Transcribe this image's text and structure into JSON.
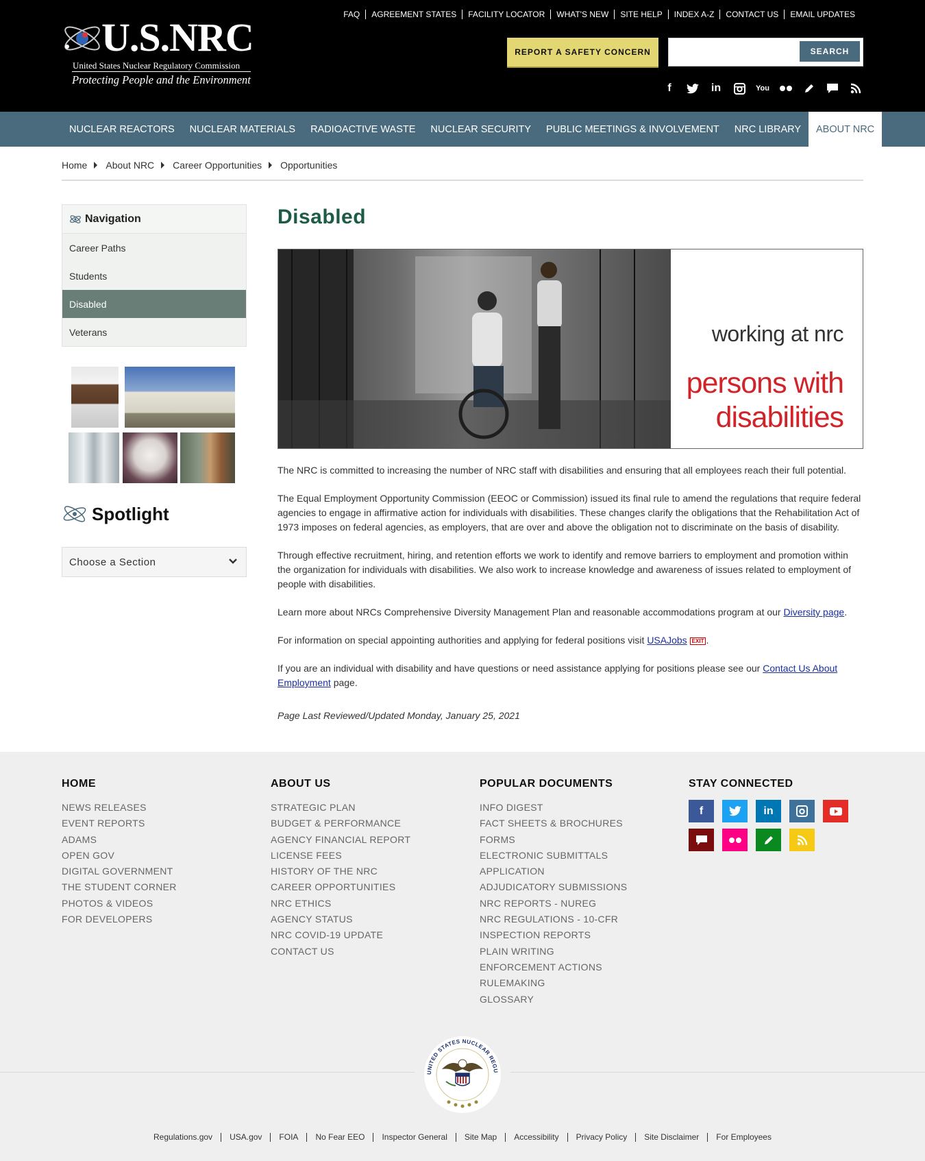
{
  "header": {
    "brand": "U.S.NRC",
    "agency_name": "United States Nuclear Regulatory Commission",
    "tagline": "Protecting People and the Environment",
    "util_links": [
      "FAQ",
      "AGREEMENT STATES",
      "FACILITY LOCATOR",
      "WHAT'S NEW",
      "SITE HELP",
      "INDEX A-Z",
      "CONTACT US",
      "EMAIL UPDATES"
    ],
    "report_button": "REPORT A SAFETY CONCERN",
    "search": {
      "placeholder": "",
      "button": "SEARCH"
    },
    "social_icons": [
      "facebook-icon",
      "twitter-icon",
      "linkedin-icon",
      "instagram-icon",
      "youtube-icon",
      "flickr-icon",
      "blog-icon",
      "comment-icon",
      "rss-icon"
    ]
  },
  "main_nav": {
    "items": [
      "NUCLEAR REACTORS",
      "NUCLEAR MATERIALS",
      "RADIOACTIVE WASTE",
      "NUCLEAR SECURITY",
      "PUBLIC MEETINGS & INVOLVEMENT",
      "NRC LIBRARY",
      "ABOUT NRC"
    ],
    "active": "ABOUT NRC"
  },
  "breadcrumb": [
    "Home",
    "About NRC",
    "Career Opportunities",
    "Opportunities"
  ],
  "sidebar": {
    "nav_title": "Navigation",
    "items": [
      "Career Paths",
      "Students",
      "Disabled",
      "Veterans"
    ],
    "active": "Disabled",
    "spotlight_title": "Spotlight",
    "choose_section": "Choose a Section"
  },
  "content": {
    "title": "Disabled",
    "hero": {
      "line1": "working at nrc",
      "line2a": "persons with",
      "line2b": "disabilities"
    },
    "p1": "The NRC is committed to increasing the number of NRC staff with disabilities and ensuring that all employees reach their full potential.",
    "p2": "The Equal Employment Opportunity Commission (EEOC or Commission) issued its final rule to amend the regulations that require federal agencies to engage in affirmative action for individuals with disabilities. These changes clarify the obligations that the Rehabilitation Act of 1973 imposes on federal agencies, as employers, that are over and above the obligation not to discriminate on the basis of disability.",
    "p3": "Through effective recruitment, hiring, and retention efforts we work to identify and remove barriers to employment and promotion within the organization for individuals with disabilities. We also work to increase knowledge and awareness of issues related to employment of people with disabilities.",
    "p4_pre": "Learn more about NRCs Comprehensive Diversity Management Plan and reasonable accommodations program at our ",
    "p4_link": "Diversity page",
    "p4_post": ".",
    "p5_pre": "For information on special appointing authorities and applying for federal positions visit ",
    "p5_link": "USAJobs",
    "p5_exit": "EXIT",
    "p5_post": ".",
    "p6_pre": "If you are an individual with disability and have questions or need assistance applying for positions please see our ",
    "p6_link": "Contact Us About Employment",
    "p6_post": " page.",
    "reviewed": "Page Last Reviewed/Updated Monday, January 25, 2021"
  },
  "footer": {
    "home": {
      "title": "HOME",
      "links": [
        "NEWS RELEASES",
        "EVENT REPORTS",
        "ADAMS",
        "OPEN GOV",
        "DIGITAL GOVERNMENT",
        "THE STUDENT CORNER",
        "PHOTOS & VIDEOS",
        "FOR DEVELOPERS"
      ]
    },
    "about": {
      "title": "ABOUT US",
      "links": [
        "STRATEGIC PLAN",
        "BUDGET & PERFORMANCE",
        "AGENCY FINANCIAL REPORT",
        "LICENSE FEES",
        "HISTORY OF THE NRC",
        "CAREER OPPORTUNITIES",
        "NRC ETHICS",
        "AGENCY STATUS",
        "NRC COVID-19 UPDATE",
        "CONTACT US"
      ]
    },
    "docs": {
      "title": "POPULAR DOCUMENTS",
      "links": [
        "INFO DIGEST",
        "FACT SHEETS & BROCHURES",
        "FORMS",
        "ELECTRONIC SUBMITTALS",
        "APPLICATION",
        "ADJUDICATORY SUBMISSIONS",
        "NRC REPORTS - NUREG",
        "NRC REGULATIONS - 10-CFR",
        "INSPECTION REPORTS",
        "PLAIN WRITING",
        "ENFORCEMENT ACTIONS",
        "RULEMAKING",
        "GLOSSARY"
      ]
    },
    "connect": {
      "title": "STAY CONNECTED",
      "colors": {
        "facebook": "#3b5998",
        "twitter": "#1da1f2",
        "linkedin": "#0077b5",
        "instagram": "#3f729b",
        "youtube": "#e52d27",
        "comment": "#7a0e0e",
        "flickr": "#ff0084",
        "blog": "#0a8a1e",
        "rss": "#f6c915"
      }
    },
    "seal_text": "UNITED STATES NUCLEAR REGULATORY COMMISSION",
    "bottom_links": [
      "Regulations.gov",
      "USA.gov",
      "FOIA",
      "No Fear EEO",
      "Inspector General",
      "Site Map",
      "Accessibility",
      "Privacy Policy",
      "Site Disclaimer",
      "For Employees"
    ]
  }
}
